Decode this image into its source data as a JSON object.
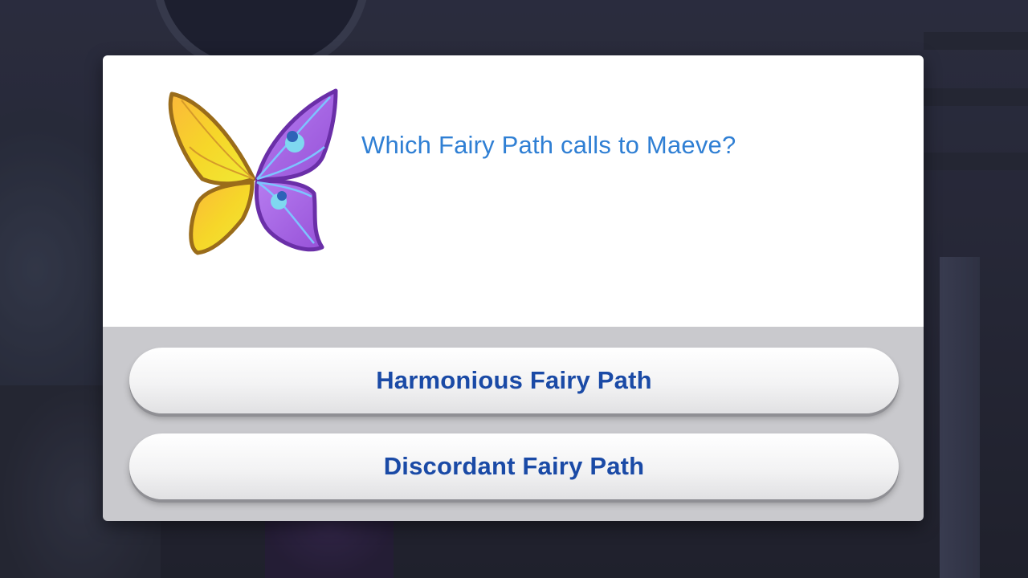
{
  "dialog": {
    "icon": "butterfly-wings-icon",
    "question": "Which Fairy Path calls to Maeve?",
    "accent_color": "#2f7fd4",
    "choices": [
      {
        "label": "Harmonious Fairy Path"
      },
      {
        "label": "Discordant Fairy Path"
      }
    ]
  }
}
